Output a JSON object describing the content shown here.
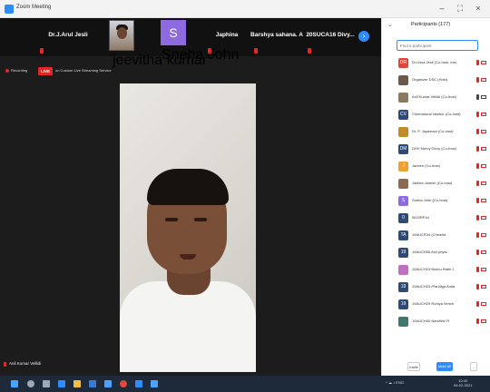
{
  "window": {
    "title": "Zoom Meeting",
    "minimize_glyph": "–",
    "maximize_glyph": "⛶",
    "close_glyph": "×"
  },
  "strip": {
    "tiles": [
      {
        "name": "Dr.J.Arul Jesli"
      },
      {
        "name": "Japhina"
      },
      {
        "name": "Barshya sahana. A"
      },
      {
        "name": "20SUCA16 Divy..."
      }
    ],
    "photo_caption": "jeevitha kumar",
    "avatar_letter": "S",
    "avatar_caption": "Sneha John",
    "scroll_glyph": "›"
  },
  "recording": {
    "label": "Recording",
    "live_badge": "LIVE",
    "live_text": "on Custom Live Streaming Service"
  },
  "active_speaker": {
    "name": "Anil Kumar Vellidi"
  },
  "participants_panel": {
    "collapse_glyph": "⌄",
    "title": "Participants (177)",
    "search_placeholder": "Find a participant",
    "items": [
      {
        "initials": "DR",
        "color": "#e0463b",
        "name": "Dr.Lissa Jesli (Co-host, me)"
      },
      {
        "initials": "",
        "color": "#6b5a4a",
        "name": "Organizer DSC (Host)"
      },
      {
        "initials": "",
        "color": "#8a7a60",
        "name": "Anil Kumar Vellidi (Co-host)"
      },
      {
        "initials": "CV",
        "color": "#2e4b78",
        "name": "Chinnadurai Vasikur (Co-host)"
      },
      {
        "initials": "",
        "color": "#c28c2a",
        "name": "Dr. P. Jayamani (Co-host)"
      },
      {
        "initials": "DM",
        "color": "#2e4b78",
        "name": "DHV Mercy Glory (Co-host)"
      },
      {
        "initials": "J",
        "color": "#f0a030",
        "name": "Janeen (Co-host)"
      },
      {
        "initials": "",
        "color": "#8a6a50",
        "name": "Jaslina Janesh (Co-host)"
      },
      {
        "initials": "S",
        "color": "#8d6adf",
        "name": "Sneha John (Co-host)"
      },
      {
        "initials": "0",
        "color": "#2e4b78",
        "name": "0623RP44"
      },
      {
        "initials": "TA",
        "color": "#2e4b78",
        "name": "19AUCR34 (Chinella"
      },
      {
        "initials": "19",
        "color": "#2e4b78",
        "name": "19AUCH06 Anil priyal"
      },
      {
        "initials": "",
        "color": "#c070c0",
        "name": "19AUCH23 Bushu Rathi J"
      },
      {
        "initials": "19",
        "color": "#2e4b78",
        "name": "19AUCH23 /Pandiga Anita"
      },
      {
        "initials": "19",
        "color": "#2e4b78",
        "name": "19AUCH29 Ruhiya Vench"
      },
      {
        "initials": "",
        "color": "#3a7a70",
        "name": "19AUCH40 Nandhini R"
      }
    ],
    "footer": {
      "invite": "Invite",
      "mute_all": "Mute All",
      "more": "..."
    }
  },
  "taskbar": {
    "icons": [
      {
        "name": "windows-start",
        "color": "#4aa3ff"
      },
      {
        "name": "search",
        "color": "#9aa8b8"
      },
      {
        "name": "task-view",
        "color": "#9aa8b8"
      },
      {
        "name": "edge",
        "color": "#2d8cff"
      },
      {
        "name": "file-explorer",
        "color": "#f0c040"
      },
      {
        "name": "store",
        "color": "#3a7ad0"
      },
      {
        "name": "mail",
        "color": "#4aa3ff"
      },
      {
        "name": "chrome",
        "color": "#e04a3a"
      },
      {
        "name": "zoom",
        "color": "#2d8cff"
      },
      {
        "name": "app",
        "color": "#4aa3ff"
      }
    ],
    "tray_text": "^ ☁ ♪ ENG",
    "clock_time": "10:40",
    "clock_date": "06-02-2021"
  }
}
